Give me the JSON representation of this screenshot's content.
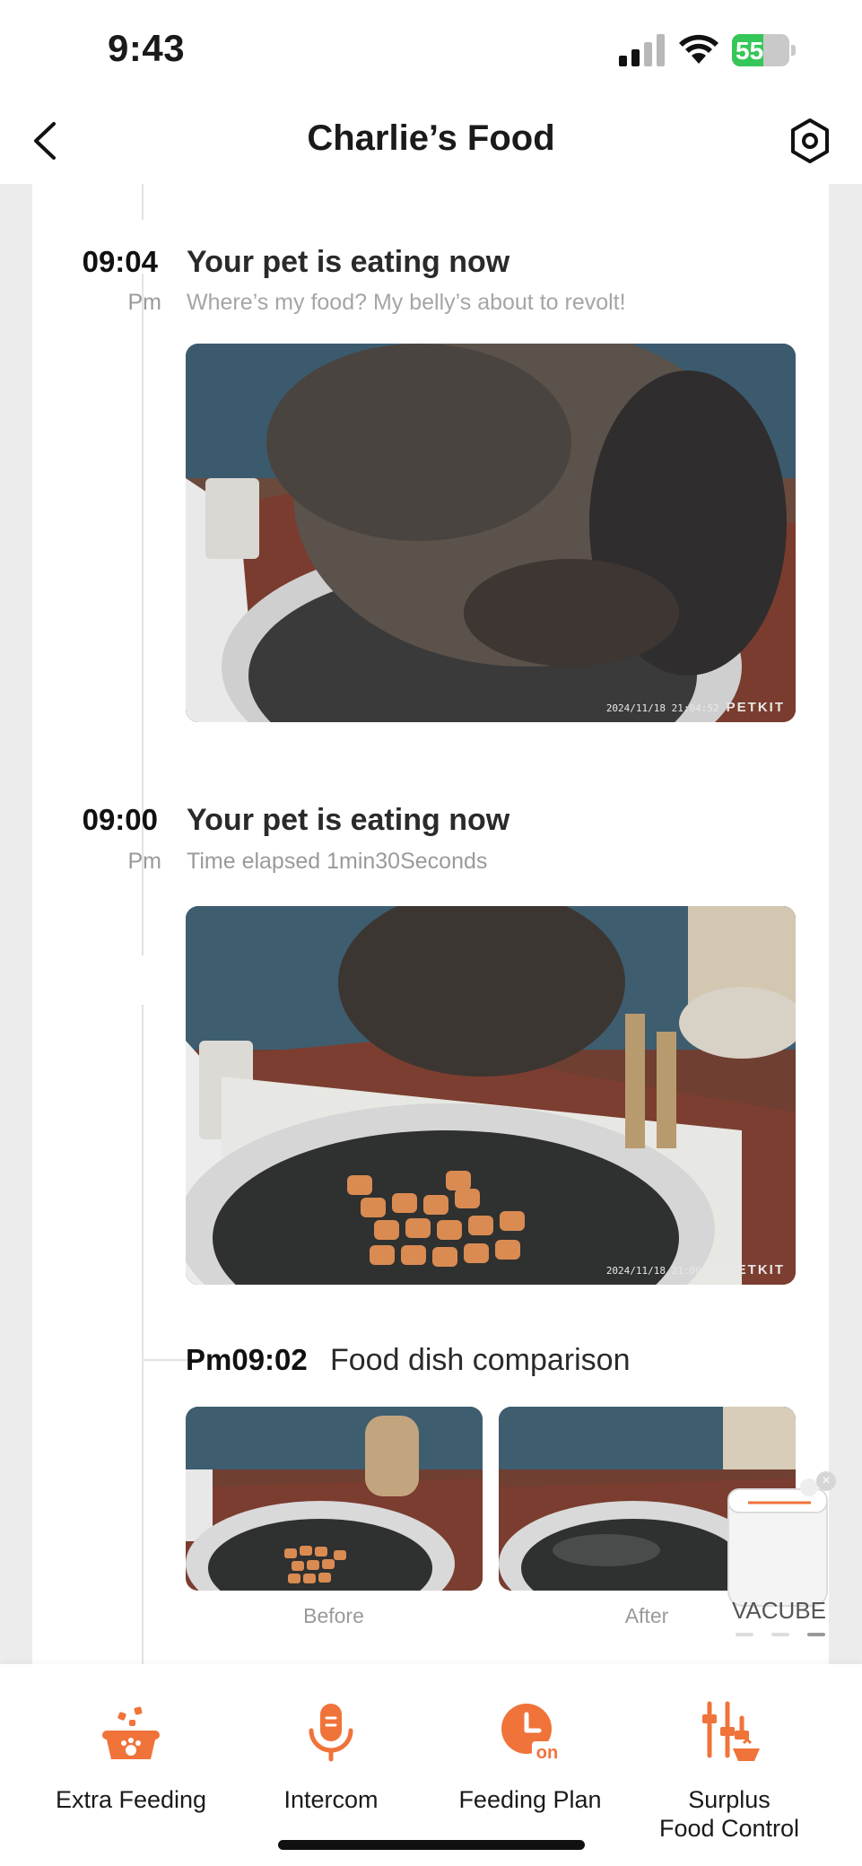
{
  "status_bar": {
    "time": "9:43",
    "battery": "55",
    "battery_level": 0.55
  },
  "nav": {
    "title": "Charlie’s Food"
  },
  "events": [
    {
      "time": "09:04",
      "ampm": "Pm",
      "title": "Your pet is eating now",
      "subtitle": "Where’s my food? My belly’s about to revolt!",
      "photo_stamp": "2024/11/18 21:04:52",
      "photo_brand": "PETKIT"
    },
    {
      "time": "09:00",
      "ampm": "Pm",
      "title": "Your pet is eating now",
      "subtitle": "Time elapsed 1min30Seconds",
      "photo_stamp": "2024/11/18 21:00:55",
      "photo_brand": "PETKIT"
    }
  ],
  "comparison": {
    "time": "Pm09:02",
    "title": "Food dish comparison",
    "before_label": "Before",
    "after_label": "After"
  },
  "promo": {
    "label": "VACUBE",
    "close": "×"
  },
  "toolbar": {
    "items": [
      {
        "label": "Extra Feeding",
        "icon": "paw-bowl-icon"
      },
      {
        "label": "Intercom",
        "icon": "microphone-icon"
      },
      {
        "label": "Feeding Plan",
        "icon": "clock-on-icon"
      },
      {
        "label": "Surplus\nFood Control",
        "icon": "sliders-bowl-icon"
      }
    ],
    "accent": "#f0733a"
  }
}
